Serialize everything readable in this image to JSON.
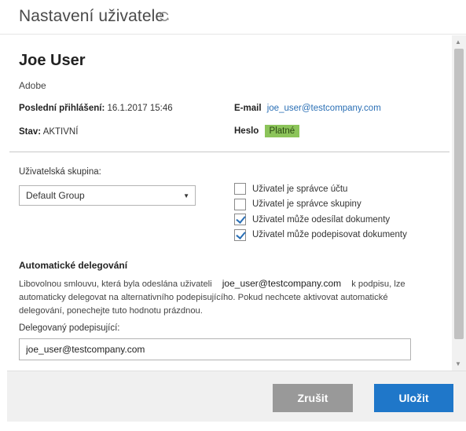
{
  "header": {
    "title": "Nastavení uživatele",
    "refresh_icon": "refresh-icon"
  },
  "user": {
    "name": "Joe User",
    "organization": "Adobe",
    "last_login_label": "Poslední přihlášení:",
    "last_login_value": "16.1.2017 15:46",
    "email_label": "E-mail",
    "email_value": "joe_user@testcompany.com",
    "status_label": "Stav:",
    "status_value": "AKTIVNÍ",
    "password_label": "Heslo",
    "password_value": "Platné",
    "password_badge_color": "#8cc45a"
  },
  "group": {
    "label": "Uživatelská skupina:",
    "selected": "Default Group"
  },
  "permissions": [
    {
      "label": "Uživatel je správce účtu",
      "checked": false
    },
    {
      "label": "Uživatel je správce skupiny",
      "checked": false
    },
    {
      "label": "Uživatel může odesílat dokumenty",
      "checked": true
    },
    {
      "label": "Uživatel může podepisovat dokumenty",
      "checked": true
    }
  ],
  "delegation": {
    "title": "Automatické delegování",
    "desc_part1": "Libovolnou smlouvu, která byla odeslána uživateli",
    "desc_email": "joe_user@testcompany.com",
    "desc_part2": "k podpisu, lze automaticky delegovat na alternativního podepisujícího. Pokud nechcete aktivovat automatické delegování, ponechejte tuto hodnotu prázdnou.",
    "field_label": "Delegovaný podepisující:",
    "field_value": "joe_user@testcompany.com"
  },
  "footer": {
    "cancel_label": "Zrušit",
    "save_label": "Uložit",
    "cancel_color": "#999999",
    "save_color": "#1f77c9"
  }
}
